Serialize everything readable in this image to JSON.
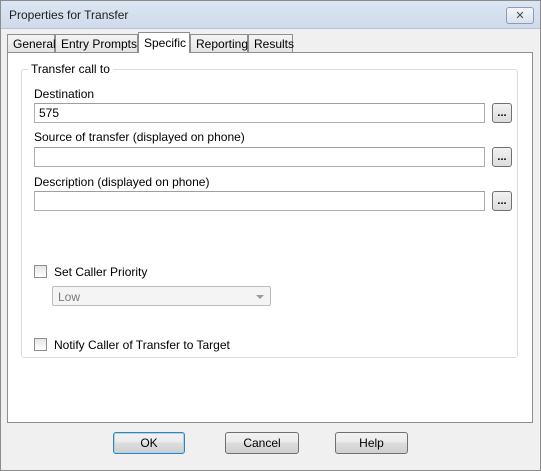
{
  "window": {
    "title": "Properties for Transfer",
    "close_glyph": "✕"
  },
  "tabs": [
    {
      "label": "General"
    },
    {
      "label": "Entry Prompts"
    },
    {
      "label": "Specific"
    },
    {
      "label": "Reporting"
    },
    {
      "label": "Results"
    }
  ],
  "active_tab": "Specific",
  "group": {
    "label": "Transfer call to"
  },
  "fields": {
    "destination": {
      "label": "Destination",
      "value": "575"
    },
    "source": {
      "label": "Source of transfer (displayed on phone)",
      "value": ""
    },
    "description": {
      "label": "Description (displayed on phone)",
      "value": ""
    }
  },
  "browse_label": "...",
  "set_caller_priority": {
    "label": "Set Caller Priority",
    "checked": false
  },
  "priority_select": {
    "value": "Low",
    "enabled": false
  },
  "notify_caller": {
    "label": "Notify Caller of Transfer to Target",
    "checked": false
  },
  "buttons": {
    "ok": "OK",
    "cancel": "Cancel",
    "help": "Help"
  },
  "colors": {
    "title_bar": "#d4e0ef",
    "default_button_border": "#3c7fb1",
    "panel_bg": "#ffffff",
    "window_bg": "#f0f0f0"
  }
}
